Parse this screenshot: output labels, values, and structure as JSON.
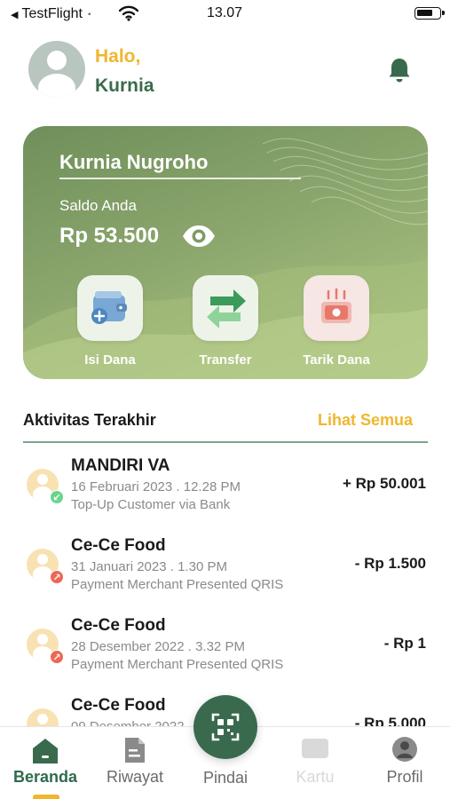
{
  "status_bar": {
    "back_app": "TestFlight",
    "time": "13.07"
  },
  "header": {
    "greeting": "Halo,",
    "user_first_name": "Kurnia"
  },
  "card": {
    "holder_name": "Kurnia Nugroho",
    "balance_label": "Saldo Anda",
    "balance": "Rp 53.500",
    "actions": [
      {
        "label": "Isi Dana",
        "icon": "wallet-plus-icon"
      },
      {
        "label": "Transfer",
        "icon": "transfer-arrows-icon"
      },
      {
        "label": "Tarik Dana",
        "icon": "cash-withdraw-icon"
      }
    ]
  },
  "activity": {
    "title": "Aktivitas Terakhir",
    "see_all": "Lihat Semua",
    "items": [
      {
        "name": "MANDIRI VA",
        "date": "16 Februari 2023 . 12.28 PM",
        "desc": "Top-Up Customer via Bank",
        "amount": "+ Rp 50.001",
        "direction": "in"
      },
      {
        "name": "Ce-Ce Food",
        "date": "31 Januari 2023 . 1.30 PM",
        "desc": "Payment Merchant Presented QRIS",
        "amount": "- Rp 1.500",
        "direction": "out"
      },
      {
        "name": "Ce-Ce Food",
        "date": "28 Desember 2022 . 3.32 PM",
        "desc": "Payment Merchant Presented QRIS",
        "amount": "- Rp 1",
        "direction": "out"
      },
      {
        "name": "Ce-Ce Food",
        "date": "09 Desember 2022",
        "desc": "",
        "amount": "- Rp 5.000",
        "direction": "out"
      }
    ]
  },
  "nav": {
    "items": [
      {
        "label": "Beranda",
        "icon": "home-icon",
        "active": true
      },
      {
        "label": "Riwayat",
        "icon": "document-icon"
      },
      {
        "label": "Pindai",
        "icon": "qr-scan-icon"
      },
      {
        "label": "Kartu",
        "icon": "card-icon",
        "disabled": true
      },
      {
        "label": "Profil",
        "icon": "profile-icon"
      }
    ]
  },
  "colors": {
    "primary_green": "#3a6a4e",
    "accent_yellow": "#f0b62e",
    "card_green": "#8ba66d",
    "incoming": "#67d68c",
    "outgoing": "#ef6655"
  }
}
